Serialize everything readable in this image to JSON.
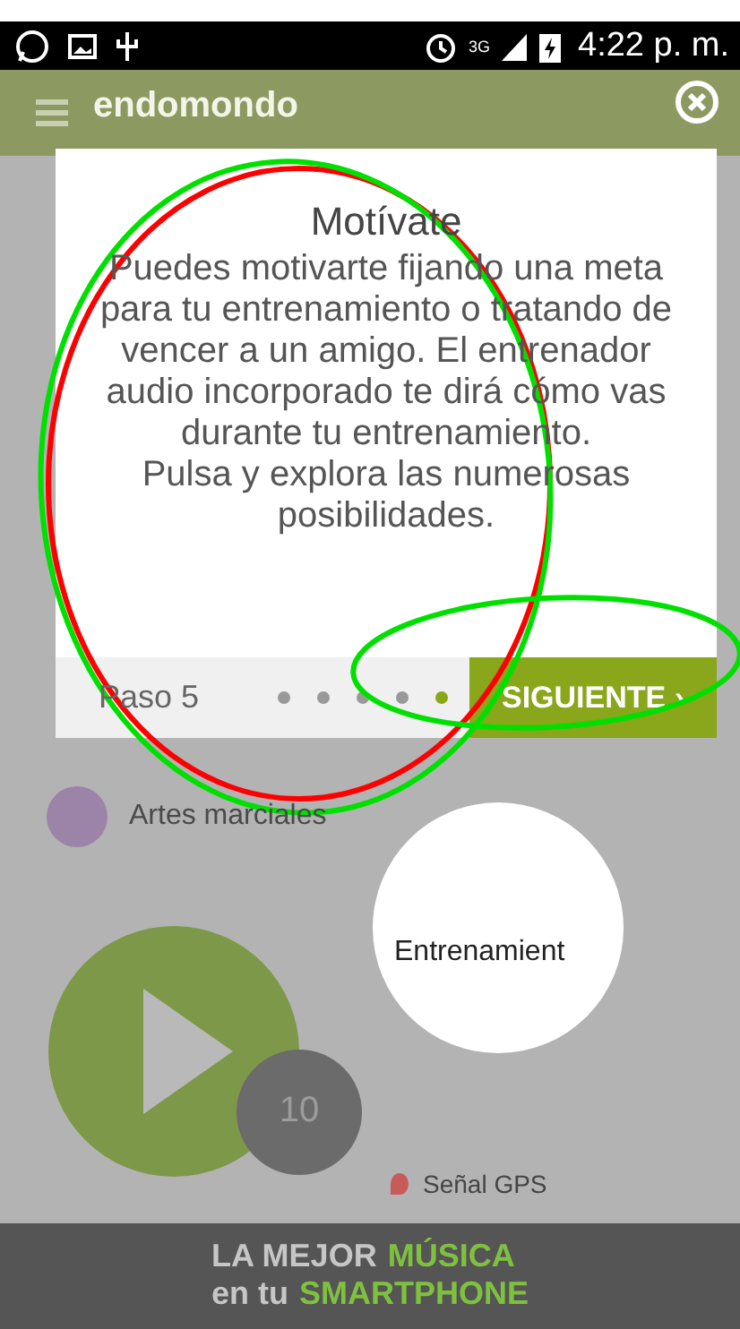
{
  "status_bar": {
    "network": "3G",
    "time": "4:22 p. m."
  },
  "app_bar": {
    "title": "endomondo"
  },
  "background": {
    "sport": "Artes marciales",
    "countdown": "10",
    "gps": "Señal GPS"
  },
  "tutorial": {
    "title": "Motívate",
    "paragraphs": [
      "Puedes motivarte fijando una meta para tu entrenamiento o tratando de vencer a un amigo. El entrenador audio incorporado te dirá cómo vas durante tu entrenamiento.",
      "Pulsa y explora las numerosas posibilidades."
    ],
    "step": "Paso 5",
    "dots": [
      {
        "selected": false
      },
      {
        "selected": false
      },
      {
        "selected": false
      },
      {
        "selected": false
      },
      {
        "selected": true
      }
    ],
    "next_button": "SIGUIENTE",
    "next_arrow": "›",
    "spotlight_label": "Entrenamient"
  },
  "ad": {
    "lines": [
      [
        {
          "text": "LA MEJOR",
          "highlight": false
        },
        {
          "text": "MÚSICA",
          "highlight": true
        }
      ],
      [
        {
          "text": "en tu",
          "highlight": false
        },
        {
          "text": "SMARTPHONE",
          "highlight": true
        }
      ]
    ]
  },
  "annotations": [
    {
      "kind": "ellipse",
      "color": "#ff0000"
    },
    {
      "kind": "ellipse",
      "color": "#00e000"
    },
    {
      "kind": "ellipse",
      "color": "#00e000"
    }
  ]
}
